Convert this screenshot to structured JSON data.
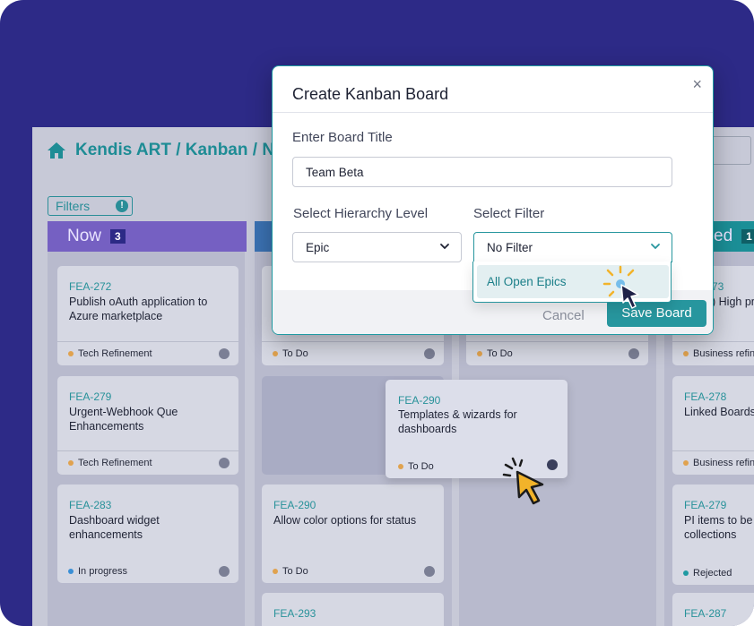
{
  "breadcrumb": {
    "text": "Kendis ART / Kanban / N"
  },
  "toolbar": {
    "filters_label": "Filters",
    "filters_badge": "!"
  },
  "columns": [
    {
      "name": "Now",
      "count": "3",
      "color": "#6f55c7"
    },
    {
      "name": "",
      "count": "",
      "color": "#3a6fb0"
    },
    {
      "name": "",
      "count": "",
      "color": "#3a6fb0"
    },
    {
      "name": "ed",
      "count": "1",
      "color": "#1b8f97"
    }
  ],
  "cards": {
    "c1": {
      "id": "FEA-272",
      "title": "Publish oAuth application to Azure marketplace",
      "status": "Tech Refinement"
    },
    "c2": {
      "id": "FEA-279",
      "title": "Urgent-Webhook Que Enhancements",
      "status": "Tech Refinement"
    },
    "c3": {
      "id": "FEA-283",
      "title": "Dashboard widget enhancements",
      "status": "In progress"
    },
    "c4": {
      "status": "To Do"
    },
    "c5": {
      "id": "FEA-290",
      "title": "Allow color options for status",
      "status": "To Do"
    },
    "c6": {
      "id": "FEA-293"
    },
    "c7": {
      "status": "To Do"
    },
    "c8": {
      "id": "73",
      "title": ") High pr",
      "status": "Business refin"
    },
    "c9": {
      "id": "FEA-278",
      "title": "Linked Boards",
      "status": "Business refin"
    },
    "c10": {
      "id": "FEA-279",
      "title": "PI items to be e collections",
      "status": "Rejected"
    },
    "c11": {
      "id": "FEA-287"
    },
    "drag": {
      "id": "FEA-290",
      "title": "Templates & wizards for dashboards",
      "status": "To Do"
    }
  },
  "modal": {
    "title": "Create Kanban Board",
    "close": "×",
    "board_title_label": "Enter Board Title",
    "board_title_value": "Team Beta",
    "hierarchy_label": "Select Hierarchy Level",
    "hierarchy_value": "Epic",
    "filter_label": "Select Filter",
    "filter_value": "No Filter",
    "filter_options": [
      "All Open Epics"
    ],
    "cancel_label": "Cancel",
    "save_label": "Save Board"
  },
  "colors": {
    "background": "#2d2a87",
    "accent": "#27969e",
    "status_tech_refinement": "#e0a24f",
    "status_in_progress": "#3a8fd6",
    "status_todo": "#e0a24f",
    "status_rejected": "#1f9aa2"
  },
  "icons": [
    "home-icon",
    "close-icon",
    "chevron-down-icon",
    "cursor-arrow-icon",
    "avatar-icon"
  ]
}
